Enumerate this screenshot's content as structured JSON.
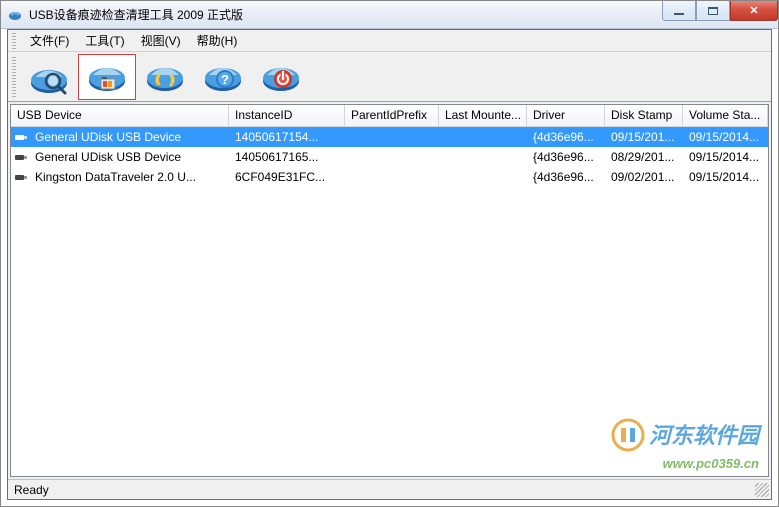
{
  "window": {
    "title": "USB设备痕迹检查清理工具 2009 正式版"
  },
  "menu": {
    "file": "文件(F)",
    "tools": "工具(T)",
    "view": "视图(V)",
    "help": "帮助(H)"
  },
  "toolbar": {
    "btn1": "scan",
    "btn2": "clean",
    "btn3": "refresh",
    "btn4": "help",
    "btn5": "power"
  },
  "columns": {
    "device": "USB Device",
    "instance": "InstanceID",
    "parent": "ParentIdPrefix",
    "last": "Last Mounte...",
    "driver": "Driver",
    "disk": "Disk Stamp",
    "volume": "Volume Sta..."
  },
  "rows": [
    {
      "device": "General UDisk USB Device",
      "instance": "14050617154...",
      "parent": "",
      "last": "",
      "driver": "{4d36e96...",
      "disk": "09/15/201...",
      "volume": "09/15/2014...",
      "selected": true
    },
    {
      "device": "General UDisk USB Device",
      "instance": "14050617165...",
      "parent": "",
      "last": "",
      "driver": "{4d36e96...",
      "disk": "08/29/201...",
      "volume": "09/15/2014...",
      "selected": false
    },
    {
      "device": "Kingston DataTraveler 2.0 U...",
      "instance": "6CF049E31FC...",
      "parent": "",
      "last": "",
      "driver": "{4d36e96...",
      "disk": "09/02/201...",
      "volume": "09/15/2014...",
      "selected": false
    }
  ],
  "statusbar": {
    "text": "Ready"
  },
  "watermark": {
    "text": "河东软件园",
    "url": "www.pc0359.cn"
  }
}
